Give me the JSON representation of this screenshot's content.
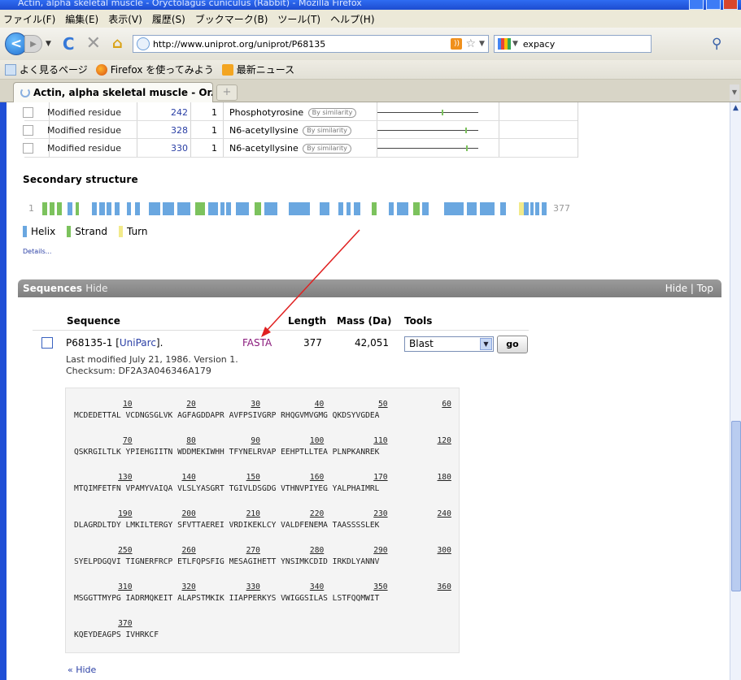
{
  "window": {
    "title": "Actin, alpha skeletal muscle - Oryctolagus cuniculus (Rabbit) - Mozilla Firefox"
  },
  "menu": [
    "ファイル(F)",
    "編集(E)",
    "表示(V)",
    "履歴(S)",
    "ブックマーク(B)",
    "ツール(T)",
    "ヘルプ(H)"
  ],
  "nav": {
    "url": "http://www.uniprot.org/uniprot/P68135",
    "search_value": "expacy",
    "back_glyph": "<",
    "reload_glyph": "C",
    "stop_glyph": "✕",
    "home_glyph": "⌂"
  },
  "bookmarks": [
    "よく見るページ",
    "Firefox を使ってみよう",
    "最新ニュース"
  ],
  "tab": {
    "label": "Actin, alpha skeletal muscle - Or...",
    "newtab": "+"
  },
  "features": [
    {
      "type": "Modified residue",
      "position": "242",
      "length": "1",
      "description": "Phosphotyrosine",
      "badge": "By similarity",
      "marker_fraction": 0.64
    },
    {
      "type": "Modified residue",
      "position": "328",
      "length": "1",
      "description": "N6-acetyllysine",
      "badge": "By similarity",
      "marker_fraction": 0.87
    },
    {
      "type": "Modified residue",
      "position": "330",
      "length": "1",
      "description": "N6-acetyllysine",
      "badge": "By similarity",
      "marker_fraction": 0.875
    }
  ],
  "secondary_structure": {
    "title": "Secondary structure",
    "start": "1",
    "end": "377",
    "legend": [
      {
        "label": "Helix",
        "color": "#6aa7e0"
      },
      {
        "label": "Strand",
        "color": "#7cc25d"
      },
      {
        "label": "Turn",
        "color": "#f2ea8a"
      }
    ],
    "details_link": "Details..."
  },
  "sequences": {
    "section_title": "Sequences",
    "section_hide": "Hide",
    "header_right": "Hide | Top",
    "columns": {
      "sequence": "Sequence",
      "length": "Length",
      "mass": "Mass (Da)",
      "tools": "Tools"
    },
    "row": {
      "id": "P68135-1",
      "uniparc": "UniParc",
      "fasta": "FASTA",
      "length": "377",
      "mass": "42,051",
      "tool_selected": "Blast",
      "go_label": "go",
      "last_modified": "Last modified July 21, 1986. Version 1.",
      "checksum": "Checksum: DF2A3A046346A179"
    },
    "blocks": [
      {
        "nums": [
          "10",
          "20",
          "30",
          "40",
          "50",
          "60"
        ],
        "seq": "MCDEDETTAL VCDNGSGLVK AGFAGDDAPR AVFPSIVGRP RHQGVMVGMG QKDSYVGDEA"
      },
      {
        "nums": [
          "70",
          "80",
          "90",
          "100",
          "110",
          "120"
        ],
        "seq": "QSKRGILTLK YPIEHGIITN WDDMEKIWHH TFYNELRVAP EEHPTLLTEA PLNPKANREK"
      },
      {
        "nums": [
          "130",
          "140",
          "150",
          "160",
          "170",
          "180"
        ],
        "seq": "MTQIMFETFN VPAMYVAIQA VLSLYASGRT TGIVLDSGDG VTHNVPIYEG YALPHAIMRL"
      },
      {
        "nums": [
          "190",
          "200",
          "210",
          "220",
          "230",
          "240"
        ],
        "seq": "DLAGRDLTDY LMKILTERGY SFVTTAEREI VRDIKEKLCY VALDFENEMA TAASSSSLEK"
      },
      {
        "nums": [
          "250",
          "260",
          "270",
          "280",
          "290",
          "300"
        ],
        "seq": "SYELPDGQVI TIGNERFRCP ETLFQPSFIG MESAGIHETT YNSIMKCDID IRKDLYANNV"
      },
      {
        "nums": [
          "310",
          "320",
          "330",
          "340",
          "350",
          "360"
        ],
        "seq": "MSGGTTMYPG IADRMQKEIT ALAPSTMKIK IIAPPERKYS VWIGGSILAS LSTFQQMWIT"
      },
      {
        "nums": [
          "370"
        ],
        "seq": "KQEYDEAGPS IVHRKCF"
      }
    ],
    "hide_link": "« Hide"
  },
  "colors": {
    "link": "#2a3fa5",
    "fasta": "#8a1a7c",
    "arrow": "#e02020",
    "chrome": "#1f4fd6"
  }
}
